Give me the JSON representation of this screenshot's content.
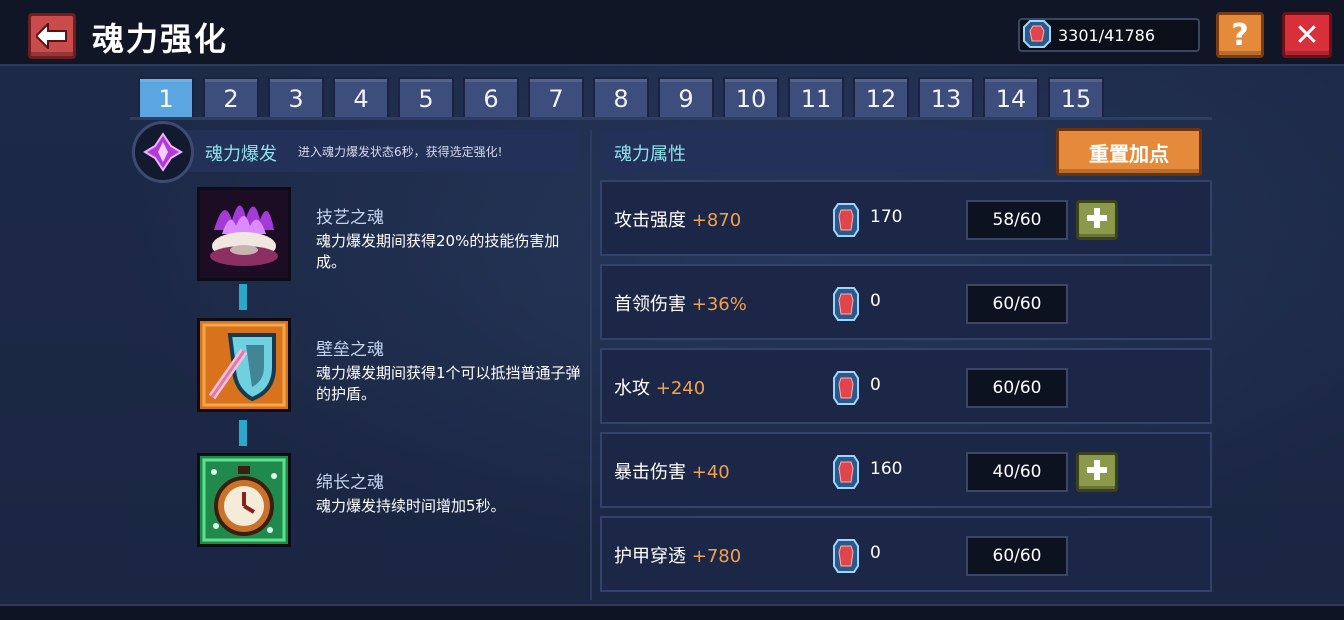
{
  "header": {
    "title": "魂力强化",
    "currency": "3301/41786",
    "help_label": "?",
    "close_label": "✕"
  },
  "tabs": [
    "1",
    "2",
    "3",
    "4",
    "5",
    "6",
    "7",
    "8",
    "9",
    "10",
    "11",
    "12",
    "13",
    "14",
    "15"
  ],
  "active_tab": "1",
  "burst": {
    "title": "魂力爆发",
    "description": "进入魂力爆发状态6秒，获得选定强化!"
  },
  "skills": [
    {
      "name": "技艺之魂",
      "desc": "魂力爆发期间获得20%的技能伤害加成。",
      "icon": "purple-flame-shell-icon"
    },
    {
      "name": "壁垒之魂",
      "desc": "魂力爆发期间获得1个可以抵挡普通子弹的护盾。",
      "icon": "shield-sword-icon"
    },
    {
      "name": "绵长之魂",
      "desc": "魂力爆发持续时间增加5秒。",
      "icon": "stopwatch-icon"
    }
  ],
  "attributes": {
    "title": "魂力属性",
    "reset_label": "重置加点",
    "rows": [
      {
        "label": "攻击强度",
        "bonus": "+870",
        "cost": "170",
        "level": "58/60",
        "upgradable": true
      },
      {
        "label": "首领伤害",
        "bonus": "+36%",
        "cost": "0",
        "level": "60/60",
        "upgradable": false
      },
      {
        "label": "水攻",
        "bonus": "+240",
        "cost": "0",
        "level": "60/60",
        "upgradable": false
      },
      {
        "label": "暴击伤害",
        "bonus": "+40",
        "cost": "160",
        "level": "40/60",
        "upgradable": true
      },
      {
        "label": "护甲穿透",
        "bonus": "+780",
        "cost": "0",
        "level": "60/60",
        "upgradable": false
      }
    ]
  },
  "colors": {
    "accent_cyan": "#8ee3ec",
    "bonus_orange": "#f3a04b",
    "active_tab": "#5ba6e0",
    "close_red": "#d8303a",
    "help_orange": "#e48a3a"
  }
}
